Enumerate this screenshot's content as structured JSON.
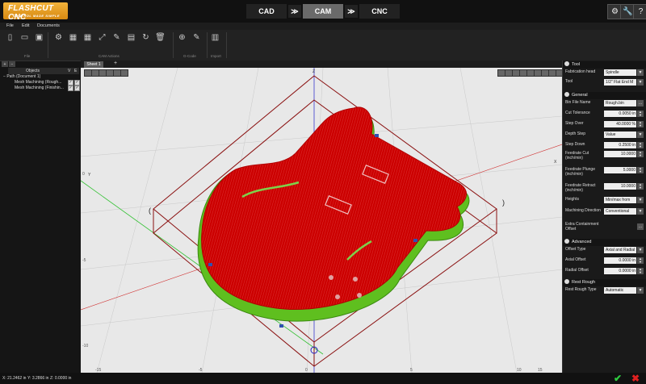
{
  "app": {
    "logo_title": "FLASHCUT CNC",
    "logo_subtitle": "CONTROL MADE SIMPLE"
  },
  "modes": [
    {
      "label": "CAD",
      "active": false
    },
    {
      "label": "CAM",
      "active": true
    },
    {
      "label": "CNC",
      "active": false
    }
  ],
  "top_icons": [
    "settings-icon",
    "wrench-icon",
    "help-icon"
  ],
  "top_icon_glyphs": [
    "⚙",
    "🔧",
    "?"
  ],
  "menu": [
    "File",
    "Edit",
    "Documents"
  ],
  "ribbon": {
    "groups": [
      {
        "label": "File",
        "icons": [
          "new-file-icon",
          "open-folder-icon",
          "save-icon"
        ],
        "glyphs": [
          "▯",
          "▭",
          "▣"
        ]
      },
      {
        "label": "CAM Actions",
        "icons": [
          "gears-icon",
          "layout-grid-icon",
          "toolpath-grid-icon",
          "expand-icon",
          "edit-path-icon",
          "image-icon",
          "redo-icon",
          "delete-icon"
        ],
        "glyphs": [
          "⚙",
          "▦",
          "▦",
          "⤢",
          "✎",
          "▤",
          "↻",
          "🗑"
        ]
      },
      {
        "label": "G-Code",
        "icons": [
          "add-gcode-icon",
          "pencil-icon"
        ],
        "glyphs": [
          "⊕",
          "✎"
        ]
      },
      {
        "label": "Import",
        "icons": [
          "import-icon"
        ],
        "glyphs": [
          "▥"
        ]
      }
    ]
  },
  "left_panel": {
    "header": "Objects",
    "header_v": "V",
    "header_e": "E",
    "tree": [
      {
        "label": "Path (Document 1)",
        "indent": 0,
        "checks": false
      },
      {
        "label": "Mesh Machining (Rough...",
        "indent": 1,
        "checks": true
      },
      {
        "label": "Mesh Machining (Finishin...",
        "indent": 1,
        "checks": true
      }
    ]
  },
  "viewport": {
    "tab": "Sheet 1",
    "add_tab": "+",
    "axis_labels": {
      "z": "Z",
      "y": "Y",
      "x": "X"
    },
    "ruler_left": [
      "0",
      "-5",
      "-10"
    ],
    "ruler_bottom": [
      "-15",
      "-5",
      "0",
      "5",
      "10",
      "15"
    ],
    "view_tools_left": [
      "zoom-fit-icon",
      "zoom-in-icon",
      "zoom-out-icon",
      "pan-icon",
      "rotate-icon",
      "camera-icon"
    ],
    "view_tools_right": [
      "view-top-icon",
      "view-front-icon",
      "view-right-icon",
      "view-iso-icon",
      "view-bottom-icon",
      "view-back-icon",
      "view-left-icon",
      "view-iso2-icon",
      "grid-toggle-icon"
    ]
  },
  "right_panel": {
    "tool_section": {
      "title": "Tool",
      "rows": [
        {
          "label": "Fabrication head",
          "value": "Spindle",
          "kind": "select"
        },
        {
          "label": "Tool",
          "value": "1/2\" Flat End M",
          "kind": "select"
        }
      ]
    },
    "general_section": {
      "title": "General",
      "rows": [
        {
          "label": "Bin File Name",
          "value": "Rough.bin",
          "kind": "button"
        },
        {
          "label": "Cut Tolerance",
          "value": "0.0050 in",
          "kind": "spin"
        },
        {
          "label": "Step Over",
          "value": "40.0000 %",
          "kind": "spin"
        },
        {
          "label": "Depth Step",
          "value": "Value",
          "kind": "select"
        },
        {
          "label": "Step Down",
          "value": "0.2500 in",
          "kind": "spin"
        },
        {
          "label": "Feedrate Cut (inch/min)",
          "value": "10.0000",
          "kind": "spin"
        },
        {
          "label": "Feedrate Plunge (inch/min)",
          "value": "5.0000",
          "kind": "spin"
        },
        {
          "label": "Feedrate Retract (inch/min)",
          "value": "10.0000",
          "kind": "spin"
        },
        {
          "label": "Heights",
          "value": "Min/max from",
          "kind": "select"
        },
        {
          "label": "Machining Direction",
          "value": "Conventional",
          "kind": "select"
        },
        {
          "label": "Extra Containment Offset",
          "value": "",
          "kind": "button"
        }
      ]
    },
    "advanced_section": {
      "title": "Advanced",
      "rows": [
        {
          "label": "Offset Type",
          "value": "Axial and Radial",
          "kind": "select"
        },
        {
          "label": "Axial Offset",
          "value": "0.0000 in",
          "kind": "spin"
        },
        {
          "label": "Radial Offset",
          "value": "0.0000 in",
          "kind": "spin"
        }
      ]
    },
    "rest_section": {
      "title": "Rest Rough",
      "rows": [
        {
          "label": "Rest Rough Type",
          "value": "Automatic",
          "kind": "select"
        }
      ]
    }
  },
  "status": {
    "x": "X: 21.2462 in",
    "y": "Y: 3.2866 in",
    "z": "Z: 0.0000 in"
  },
  "colors": {
    "accent": "#f0a020",
    "toolpath_red": "#d40000",
    "toolpath_green": "#5fbf1f",
    "ok_green": "#2ecc40",
    "cancel_red": "#e02020"
  }
}
